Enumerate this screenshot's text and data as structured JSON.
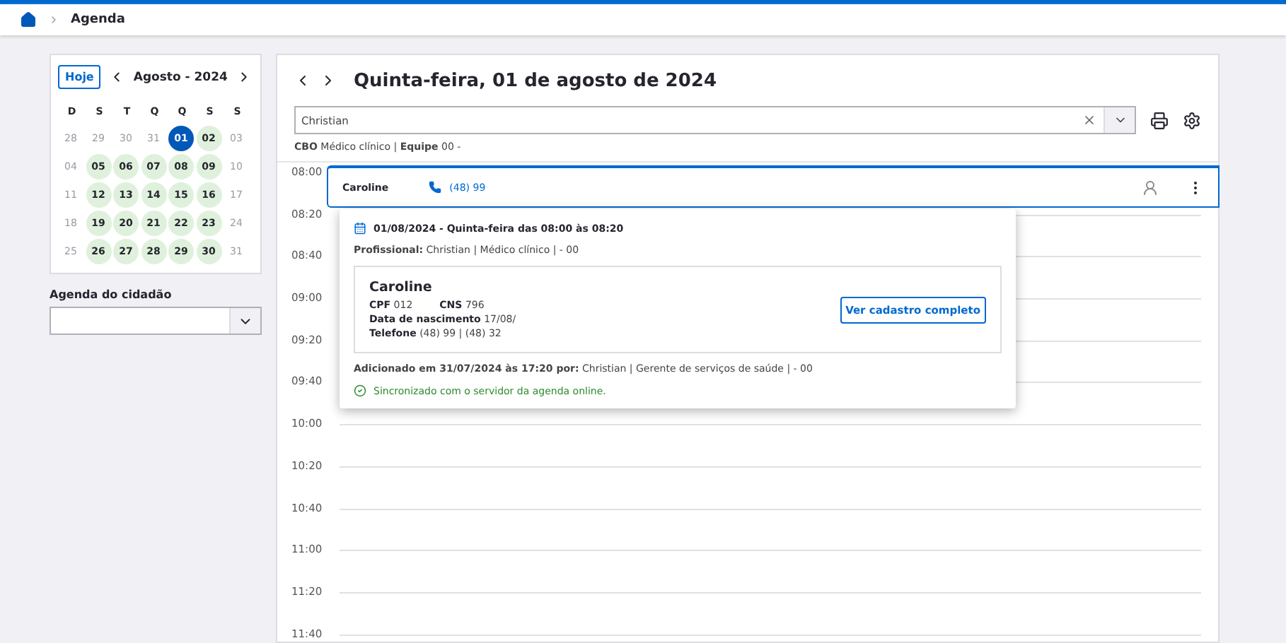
{
  "breadcrumb": {
    "items": [
      "Agenda"
    ]
  },
  "calendar": {
    "today_button": "Hoje",
    "month": "Agosto - 2024",
    "weekdays": [
      "D",
      "S",
      "T",
      "Q",
      "Q",
      "S",
      "S"
    ],
    "days": [
      {
        "label": "28",
        "kind": "outside",
        "selected": false
      },
      {
        "label": "29",
        "kind": "outside",
        "selected": false
      },
      {
        "label": "30",
        "kind": "outside",
        "selected": false
      },
      {
        "label": "31",
        "kind": "outside",
        "selected": false
      },
      {
        "label": "01",
        "kind": "available",
        "selected": true
      },
      {
        "label": "02",
        "kind": "available",
        "selected": false
      },
      {
        "label": "03",
        "kind": "plain",
        "selected": false
      },
      {
        "label": "04",
        "kind": "plain",
        "selected": false
      },
      {
        "label": "05",
        "kind": "available",
        "selected": false
      },
      {
        "label": "06",
        "kind": "available",
        "selected": false
      },
      {
        "label": "07",
        "kind": "available",
        "selected": false
      },
      {
        "label": "08",
        "kind": "available",
        "selected": false
      },
      {
        "label": "09",
        "kind": "available",
        "selected": false
      },
      {
        "label": "10",
        "kind": "plain",
        "selected": false
      },
      {
        "label": "11",
        "kind": "plain",
        "selected": false
      },
      {
        "label": "12",
        "kind": "available",
        "selected": false
      },
      {
        "label": "13",
        "kind": "available",
        "selected": false
      },
      {
        "label": "14",
        "kind": "available",
        "selected": false
      },
      {
        "label": "15",
        "kind": "available",
        "selected": false
      },
      {
        "label": "16",
        "kind": "available",
        "selected": false
      },
      {
        "label": "17",
        "kind": "plain",
        "selected": false
      },
      {
        "label": "18",
        "kind": "plain",
        "selected": false
      },
      {
        "label": "19",
        "kind": "available",
        "selected": false
      },
      {
        "label": "20",
        "kind": "available",
        "selected": false
      },
      {
        "label": "21",
        "kind": "available",
        "selected": false
      },
      {
        "label": "22",
        "kind": "available",
        "selected": false
      },
      {
        "label": "23",
        "kind": "available",
        "selected": false
      },
      {
        "label": "24",
        "kind": "plain",
        "selected": false
      },
      {
        "label": "25",
        "kind": "plain",
        "selected": false
      },
      {
        "label": "26",
        "kind": "available",
        "selected": false
      },
      {
        "label": "27",
        "kind": "available",
        "selected": false
      },
      {
        "label": "28",
        "kind": "available",
        "selected": false
      },
      {
        "label": "29",
        "kind": "available",
        "selected": false
      },
      {
        "label": "30",
        "kind": "available",
        "selected": false
      },
      {
        "label": "31",
        "kind": "plain",
        "selected": false
      }
    ]
  },
  "citizen_agenda": {
    "label": "Agenda do cidadão"
  },
  "main": {
    "title": "Quinta-feira, 01 de agosto de 2024",
    "professional_select": {
      "value": "Christian"
    },
    "info": "**CBO** Médico clínico | **Equipe** 00 -",
    "time_slots": [
      "08:00",
      "08:20",
      "08:40",
      "09:00",
      "09:20",
      "09:40",
      "10:00",
      "10:20",
      "10:40",
      "11:00",
      "11:20",
      "11:40"
    ],
    "appointment": {
      "name": "Caroline",
      "phone": "(48) 99"
    },
    "popup": {
      "date": "01/08/2024 - Quinta-feira das 08:00 às 08:20",
      "professional": "**Profissional:** Christian | Médico clínico | - 00",
      "patient": {
        "name": "Caroline",
        "lines": [
          [
            {
              "label": "CPF",
              "value": "012"
            },
            {
              "label": "CNS",
              "value": "796"
            }
          ],
          [
            {
              "label": "Data de nascimento",
              "value": "17/08/"
            }
          ],
          [
            {
              "label": "Telefone",
              "value": "(48) 99 | (48) 32"
            }
          ]
        ],
        "button": "Ver cadastro completo"
      },
      "added": "**Adicionado em 31/07/2024 às 17:20 por:** Christian | Gerente de serviços de saúde | - 00",
      "sync": "Sincronizado com o servidor da agenda online."
    }
  }
}
